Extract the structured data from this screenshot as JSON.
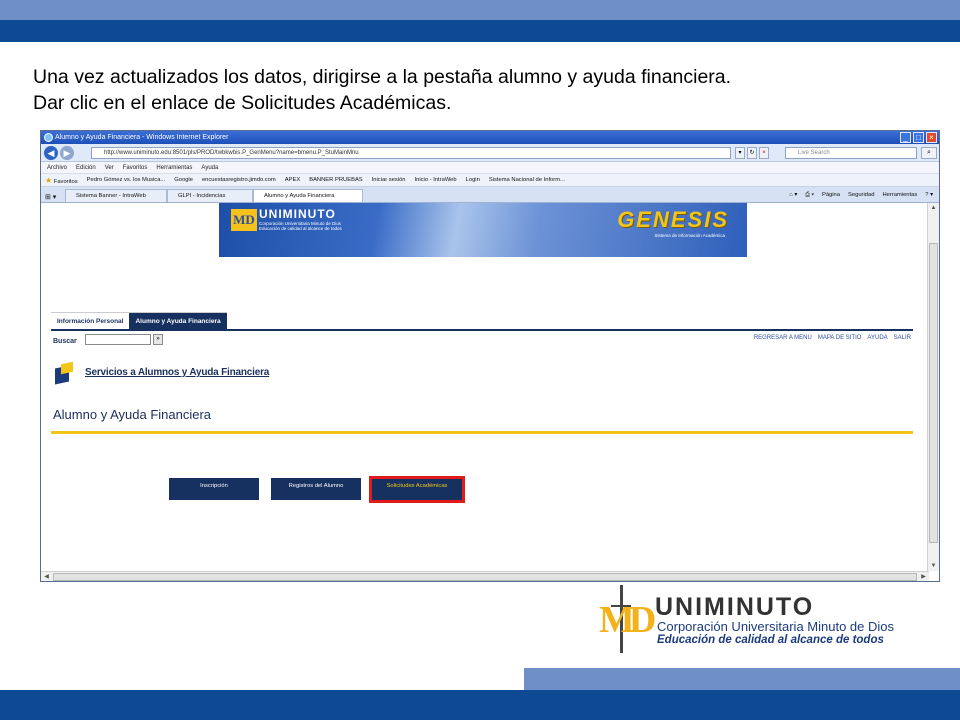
{
  "slide": {
    "instruction_line1": "Una vez actualizados los datos, dirigirse a la pestaña alumno y ayuda financiera.",
    "instruction_line2": "Dar clic en el enlace de Solicitudes Académicas."
  },
  "browser": {
    "window_title": "Alumno y Ayuda Financiera - Windows Internet Explorer",
    "url": "http://www.uniminuto.edu:8501/pls/PROD/twbkwbis.P_GenMenu?name=bmenu.P_StuMainMnu",
    "live_search_placeholder": "Live Search",
    "menu": [
      "Archivo",
      "Edición",
      "Ver",
      "Favoritos",
      "Herramientas",
      "Ayuda"
    ],
    "favorites_label": "Favoritos",
    "favorites": [
      "Pedro Gómez vs. los Musica...",
      "Google",
      "encuestasregistro.jimdo.com",
      "APEX",
      "BANNER PRUEBAS",
      "Iniciar sesión",
      "Inicio - IntraWeb",
      "Login",
      "Sistema Nacional de Inform..."
    ],
    "tabs": [
      "Sistema Banner - IntraWeb",
      "GLPI - Incidencias",
      "Alumno y Ayuda Financiera"
    ],
    "tools": [
      "Página",
      "Seguridad",
      "Herramientas"
    ]
  },
  "page": {
    "banner_brand": "UNIMINUTO",
    "banner_sub1": "Corporación Universitaria Minuto de Dios",
    "banner_sub2": "Educación de calidad al alcance de todos",
    "banner_system": "GENESIS",
    "banner_system_sub": "Sistema de Información Académica",
    "tab_personal": "Información Personal",
    "tab_student": "Alumno y Ayuda Financiera",
    "search_label": "Buscar",
    "top_links": [
      "REGRESAR A MENU",
      "MAPA DE SITIO",
      "AYUDA",
      "SALIR"
    ],
    "service_title": "Servicios a Alumnos y Ayuda Financiera",
    "heading": "Alumno y Ayuda Financiera",
    "buttons": [
      "Inscripción",
      "Registros del Alumno",
      "Solicitudes Académicas"
    ]
  },
  "footer_logo": {
    "mark": "MD",
    "name": "UNIMINUTO",
    "sub1": "Corporación Universitaria Minuto de Dios",
    "sub2": "Educación de calidad al alcance de todos"
  },
  "colors": {
    "brand_dark": "#0d4a93",
    "brand_light": "#6f8fc9",
    "gold": "#f2c619",
    "highlight": "#e01b1b"
  }
}
